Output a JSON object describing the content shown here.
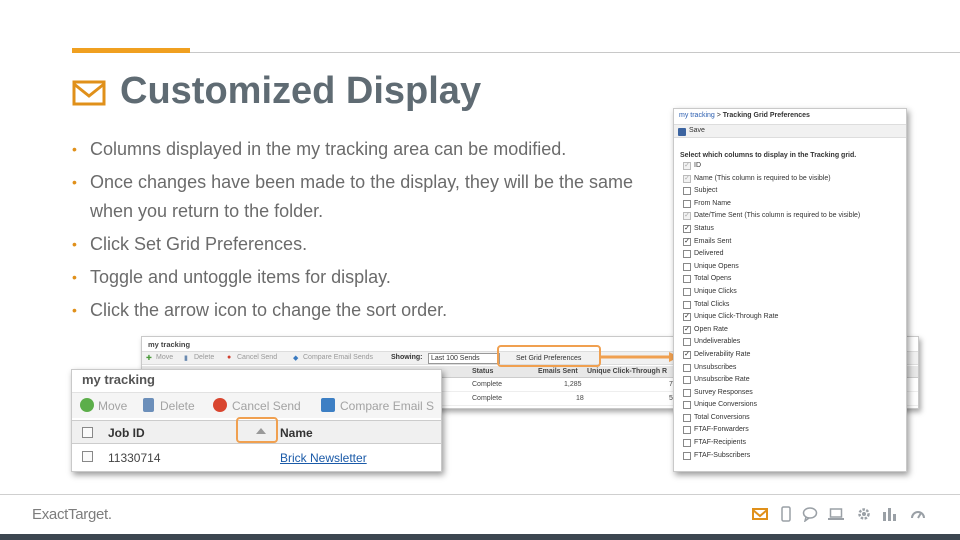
{
  "slide": {
    "title": "Customized Display",
    "bullets": [
      "Columns displayed in the my tracking area can be modified.",
      "Once changes have been made to the display, they will be the same when you return to the folder.",
      "Click Set Grid Preferences.",
      "Toggle and untoggle items for display.",
      "Click the arrow icon to change the sort order."
    ],
    "accent_color": "#f0a020",
    "title_color": "#5f6b73"
  },
  "big_grid": {
    "title": "my tracking",
    "toolbar": {
      "move": "Move",
      "delete": "Delete",
      "cancel_send": "Cancel Send",
      "compare": "Compare Email Sends",
      "showing_label": "Showing:",
      "showing_value": "Last 100 Sends",
      "set_grid": "Set Grid Preferences"
    },
    "header": {
      "status": "Status",
      "emails_sent": "Emails Sent",
      "unique_ctr": "Unique Click-Through R"
    },
    "rows": [
      {
        "status": "Complete",
        "emails_sent": "1,285",
        "ctr": "7"
      },
      {
        "status": "Complete",
        "emails_sent": "18",
        "ctr": "5"
      }
    ]
  },
  "mini_panel": {
    "title": "my tracking",
    "toolbar": {
      "move": "Move",
      "delete": "Delete",
      "cancel_send": "Cancel Send",
      "compare": "Compare Email S"
    },
    "header": {
      "job_id": "Job ID",
      "name": "Name"
    },
    "row": {
      "job_id": "11330714",
      "name": "Brick Newsletter"
    }
  },
  "prefs_panel": {
    "crumb_link": "my tracking",
    "crumb_sep": ">",
    "crumb_current": "Tracking Grid Preferences",
    "save": "Save",
    "instruction": "Select which columns to display in the Tracking grid.",
    "options": [
      {
        "label": "ID",
        "checked": true,
        "disabled": true
      },
      {
        "label": "Name (This column is required to be visible)",
        "checked": true,
        "disabled": true
      },
      {
        "label": "Subject",
        "checked": false,
        "disabled": false
      },
      {
        "label": "From Name",
        "checked": false,
        "disabled": false
      },
      {
        "label": "Date/Time Sent (This column is required to be visible)",
        "checked": true,
        "disabled": true
      },
      {
        "label": "Status",
        "checked": true,
        "disabled": false
      },
      {
        "label": "Emails Sent",
        "checked": true,
        "disabled": false
      },
      {
        "label": "Delivered",
        "checked": false,
        "disabled": false
      },
      {
        "label": "Unique Opens",
        "checked": false,
        "disabled": false
      },
      {
        "label": "Total Opens",
        "checked": false,
        "disabled": false
      },
      {
        "label": "Unique Clicks",
        "checked": false,
        "disabled": false
      },
      {
        "label": "Total Clicks",
        "checked": false,
        "disabled": false
      },
      {
        "label": "Unique Click-Through Rate",
        "checked": true,
        "disabled": false
      },
      {
        "label": "Open Rate",
        "checked": true,
        "disabled": false
      },
      {
        "label": "Undeliverables",
        "checked": false,
        "disabled": false
      },
      {
        "label": "Deliverability Rate",
        "checked": true,
        "disabled": false
      },
      {
        "label": "Unsubscribes",
        "checked": false,
        "disabled": false
      },
      {
        "label": "Unsubscribe Rate",
        "checked": false,
        "disabled": false
      },
      {
        "label": "Survey Responses",
        "checked": false,
        "disabled": false
      },
      {
        "label": "Unique Conversions",
        "checked": false,
        "disabled": false
      },
      {
        "label": "Total Conversions",
        "checked": false,
        "disabled": false
      },
      {
        "label": "FTAF-Forwarders",
        "checked": false,
        "disabled": false
      },
      {
        "label": "FTAF-Recipients",
        "checked": false,
        "disabled": false
      },
      {
        "label": "FTAF-Subscribers",
        "checked": false,
        "disabled": false
      }
    ]
  },
  "footer": {
    "logo": "ExactTarget.",
    "icons": [
      "envelope-icon",
      "mobile-icon",
      "chat-icon",
      "laptop-icon",
      "gear-icon",
      "bar-chart-icon",
      "gauge-icon"
    ]
  }
}
